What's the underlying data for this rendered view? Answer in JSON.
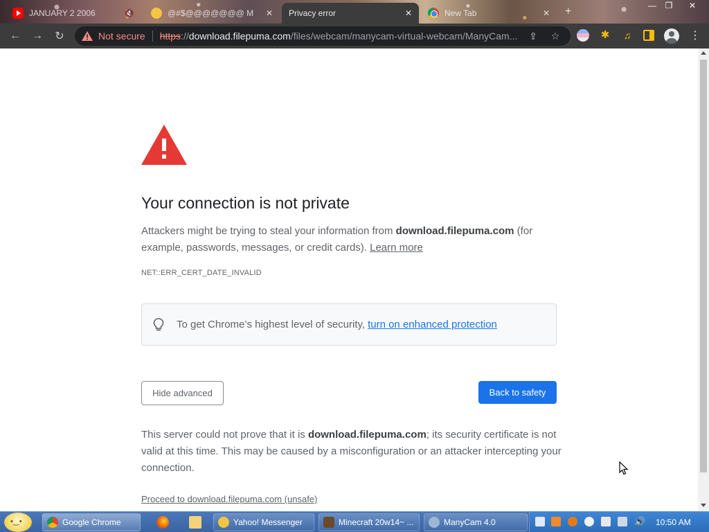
{
  "tabs": [
    {
      "title": "JANUARY 2 2006",
      "close": "🔇"
    },
    {
      "title": "@#$@@@@@@@ M",
      "close": "✕"
    },
    {
      "title": "Privacy error",
      "close": "✕",
      "active": true
    },
    {
      "title": "New Tab",
      "close": "✕"
    }
  ],
  "newtab": "+",
  "window": {
    "minimize": "—",
    "maximize": "❐",
    "close": "✕"
  },
  "toolbar": {
    "back": "←",
    "forward": "→",
    "reload": "↻",
    "security_label": "Not secure",
    "url_scheme": "https",
    "url_sep": "://",
    "url_host": "download.filepuma.com",
    "url_path": "/files/webcam/manycam-virtual-webcam/ManyCam...",
    "share": "⇪",
    "star": "☆",
    "puzzle": "✱",
    "media": "♫",
    "menu": "⋮"
  },
  "page": {
    "heading": "Your connection is not private",
    "explanation_1": "Attackers might be trying to steal your information from ",
    "host": "download.filepuma.com",
    "explanation_2": " (for example, passwords, messages, or credit cards). ",
    "learn_more": "Learn more",
    "error_code": "NET::ERR_CERT_DATE_INVALID",
    "enhanced_text": "To get Chrome’s highest level of security,",
    "enhanced_link": "turn on enhanced protection",
    "hide_advanced": "Hide advanced",
    "back_to_safety": "Back to safety",
    "details_1": "This server could not prove that it is ",
    "details_host": "download.filepuma.com",
    "details_2": "; its security certificate is not valid at this time. This may be caused by a misconfiguration or an attacker intercepting your connection.",
    "proceed": "Proceed to download.filepuma.com (unsafe)"
  },
  "taskbar": {
    "tasks": [
      {
        "label": "Google Chrome",
        "icon": "chrome-icon"
      },
      {
        "label": "Yahoo! Messenger",
        "icon": "yahoo-messenger-icon"
      },
      {
        "label": "Minecraft 20w14~ ...",
        "icon": "minecraft-icon"
      },
      {
        "label": "ManyCam 4.0",
        "icon": "manycam-icon"
      }
    ],
    "clock": "10:50 AM"
  },
  "colors": {
    "danger": "#e53935",
    "link": "#1a73e8",
    "primary_button": "#1a73e8",
    "not_secure": "#f28b82",
    "taskbar": "#3a64a4"
  }
}
